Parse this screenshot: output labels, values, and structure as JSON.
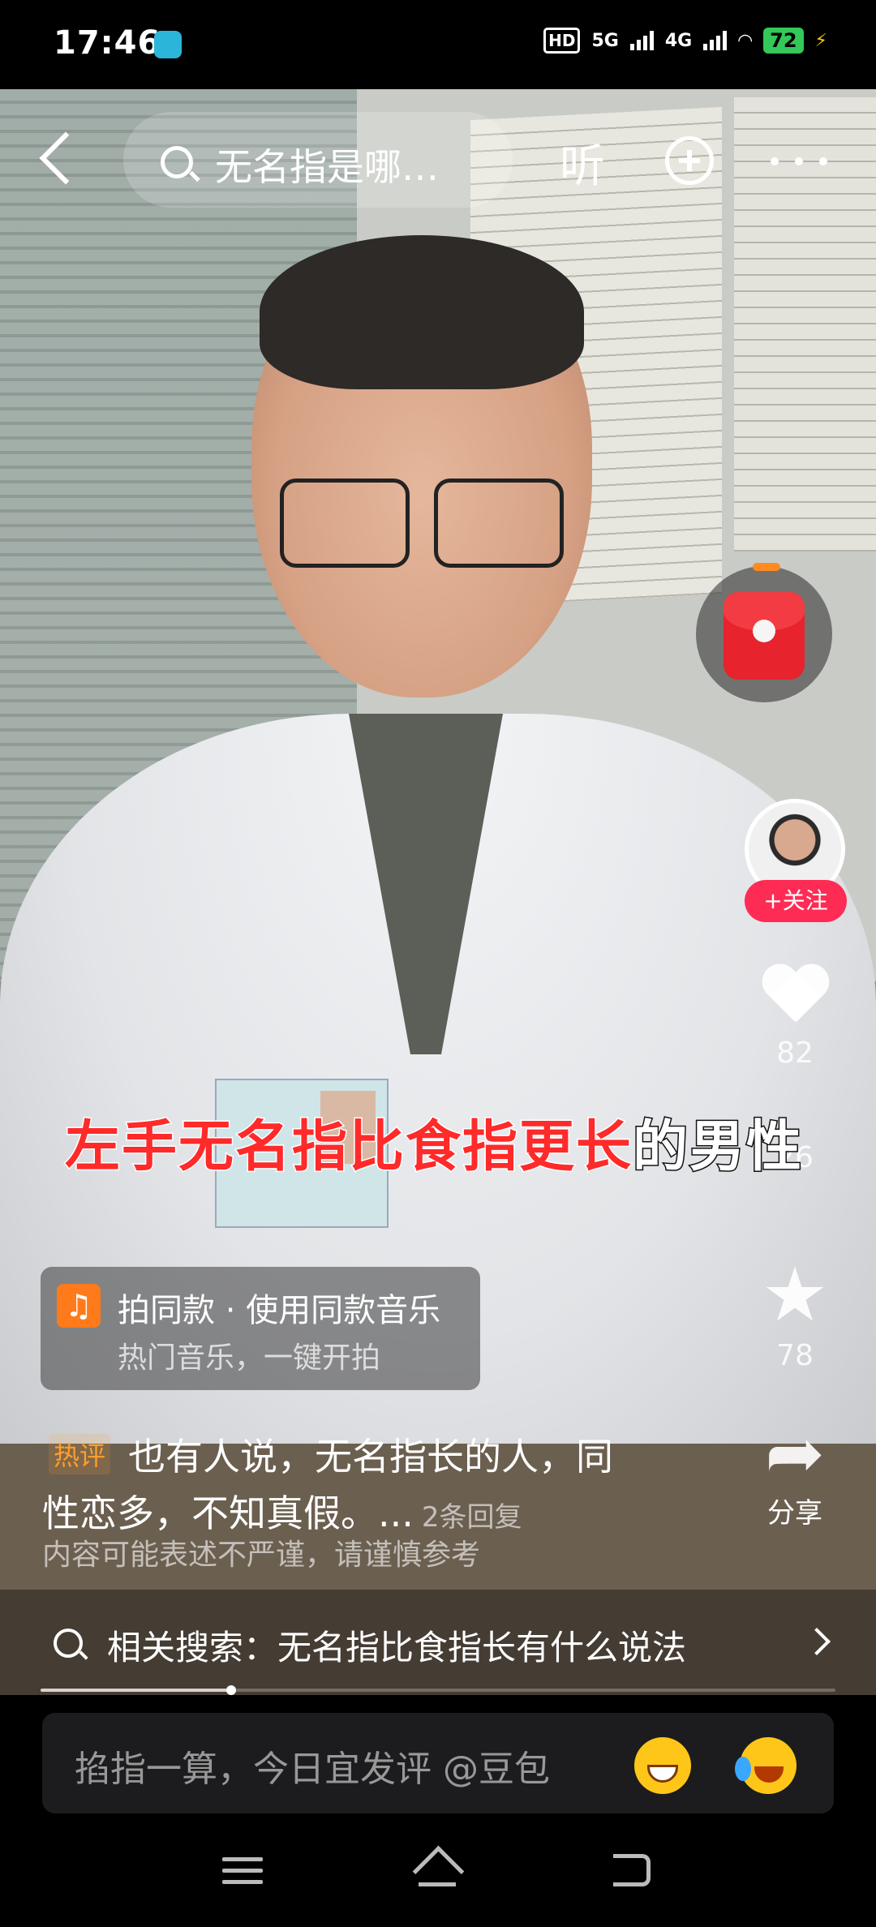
{
  "status_bar": {
    "time": "17:46",
    "network_hd": "HD",
    "network_5g": "5G",
    "network_4g": "4G",
    "battery": "72"
  },
  "top_bar": {
    "search_text": "无名指是哪…",
    "listen_label": "听"
  },
  "video": {
    "subtitle_red": "左手无名指比食指更长",
    "subtitle_white": "的男性"
  },
  "right_rail": {
    "follow_label": "+关注",
    "likes": "82",
    "comments": "26",
    "favorites": "78",
    "share_label": "分享"
  },
  "music": {
    "title": "拍同款 · 使用同款音乐",
    "subtitle": "热门音乐，一键开拍"
  },
  "hot_comment": {
    "tag": "热评",
    "line1": "也有人说，无名指长的人，同",
    "line2": "性恋多，不知真假。...",
    "replies": "2条回复",
    "disclaimer": "内容可能表述不严谨，请谨慎参考"
  },
  "related_search": {
    "text": "相关搜索：无名指比食指长有什么说法"
  },
  "playback": {
    "progress_fraction": 0.24
  },
  "comment_input": {
    "placeholder": "掐指一算，今日宜发评  @豆包"
  },
  "colors": {
    "accent": "#fe2c55",
    "subtitle_red": "#ff2a2a",
    "battery_green": "#34c759",
    "music_orange": "#ff7a1a"
  }
}
